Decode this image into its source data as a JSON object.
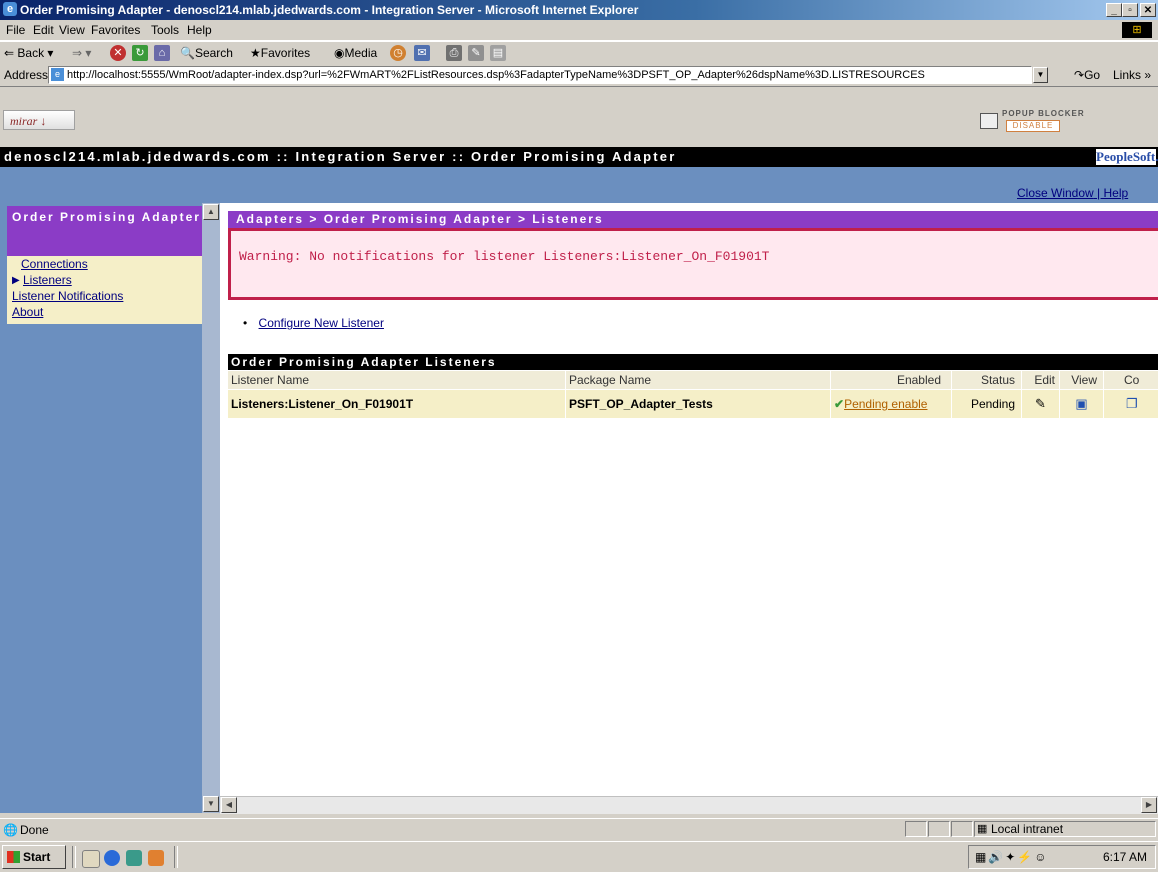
{
  "window": {
    "title": "Order Promising Adapter - denoscl214.mlab.jdedwards.com - Integration Server - Microsoft Internet Explorer",
    "controls": {
      "minimize": "_",
      "maximize": "▫",
      "close": "✕"
    }
  },
  "menu": [
    "File",
    "Edit",
    "View",
    "Favorites",
    "Tools",
    "Help"
  ],
  "toolbar": {
    "back": "Back",
    "search": "Search",
    "favorites": "Favorites",
    "media": "Media"
  },
  "address": {
    "label": "Address",
    "url": "http://localhost:5555/WmRoot/adapter-index.dsp?url=%2FWmART%2FListResources.dsp%3FadapterTypeName%3DPSFT_OP_Adapter%26dspName%3D.LISTRESOURCES",
    "go": "Go",
    "links": "Links"
  },
  "plugin": {
    "logo": "mirar",
    "popup_blocker": "POPUP BLOCKER",
    "popup_disable": "DISABLE"
  },
  "page": {
    "header": "denoscl214.mlab.jdedwards.com :: Integration Server :: Order Promising Adapter",
    "brand": "PeopleSoft.",
    "close_window": "Close Window",
    "help": "Help"
  },
  "sidebar": {
    "title": "Order Promising Adapter",
    "items": [
      {
        "label": "Connections",
        "active": false
      },
      {
        "label": "Listeners",
        "active": true
      },
      {
        "label": "Listener Notifications",
        "active": false
      },
      {
        "label": "About",
        "active": false
      }
    ]
  },
  "main": {
    "breadcrumb": "Adapters > Order Promising Adapter > Listeners",
    "warning": "Warning: No notifications for listener Listeners:Listener_On_F01901T",
    "configure_link": "Configure New Listener",
    "table_title": "Order Promising Adapter Listeners",
    "columns": [
      "Listener Name",
      "Package Name",
      "Enabled",
      "Status",
      "Edit",
      "View",
      "Co"
    ],
    "rows": [
      {
        "listener_name": "Listeners:Listener_On_F01901T",
        "package_name": "PSFT_OP_Adapter_Tests",
        "enabled": "Pending enable",
        "status": "Pending"
      }
    ]
  },
  "status": {
    "text": "Done",
    "zone": "Local intranet"
  },
  "taskbar": {
    "start": "Start",
    "clock": "6:17 AM"
  },
  "colors": {
    "accent_purple": "#8b3cc6",
    "nav_blue": "#6b8fbf",
    "warning_red": "#c0204a",
    "link_blue": "#00007f",
    "enabled_link": "#b06000"
  }
}
